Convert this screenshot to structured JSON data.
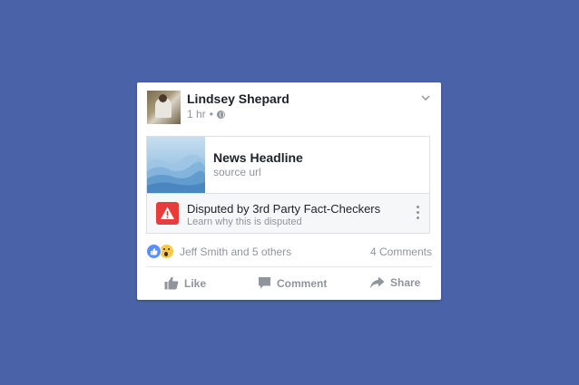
{
  "post": {
    "author": "Lindsey Shepard",
    "time": "1 hr",
    "separator": "•"
  },
  "link": {
    "title": "News Headline",
    "source": "source url"
  },
  "disputed": {
    "title": "Disputed by 3rd Party Fact-Checkers",
    "subtitle": "Learn why this is disputed"
  },
  "reactions": {
    "text": "Jeff Smith and 5 others",
    "comments": "4 Comments"
  },
  "actions": {
    "like": "Like",
    "comment": "Comment",
    "share": "Share"
  },
  "colors": {
    "background": "#4a63a8",
    "warning": "#e83b3b",
    "like_blue": "#5890ff",
    "muted": "#90949c"
  }
}
